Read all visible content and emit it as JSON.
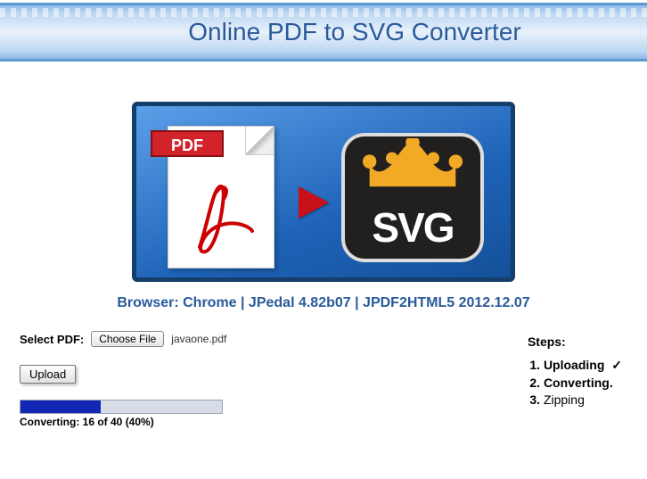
{
  "header": {
    "title": "Online PDF to SVG Converter"
  },
  "hero": {
    "pdf_badge": "PDF",
    "svg_text": "SVG"
  },
  "info_line": "Browser: Chrome | JPedal 4.82b07 | JPDF2HTML5 2012.12.07",
  "form": {
    "select_label": "Select PDF:",
    "choose_button": "Choose File",
    "filename": "javaone.pdf",
    "upload_button": "Upload"
  },
  "progress": {
    "percent": 40,
    "label": "Converting: 16 of 40 (40%)"
  },
  "steps": {
    "title": "Steps:",
    "items": [
      {
        "label": "Uploading",
        "status": "done",
        "suffix": " ✓"
      },
      {
        "label": "Converting",
        "status": "active",
        "suffix": "."
      },
      {
        "label": "Zipping",
        "status": "pending",
        "suffix": ""
      }
    ]
  }
}
